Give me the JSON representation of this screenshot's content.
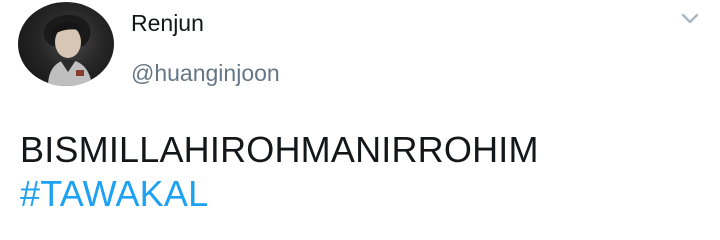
{
  "author": {
    "display_name": "Renjun",
    "handle": "@huanginjoon",
    "avatar_icon": "profile-photo"
  },
  "menu": {
    "caret_icon": "chevron-down-icon"
  },
  "tweet": {
    "line1": "BISMILLAHIROHMANIRROHIM",
    "hashtag": "#TAWAKAL"
  },
  "colors": {
    "text": "#14171a",
    "secondary": "#657786",
    "hashtag": "#1da1f2",
    "caret": "#aab8c2"
  }
}
